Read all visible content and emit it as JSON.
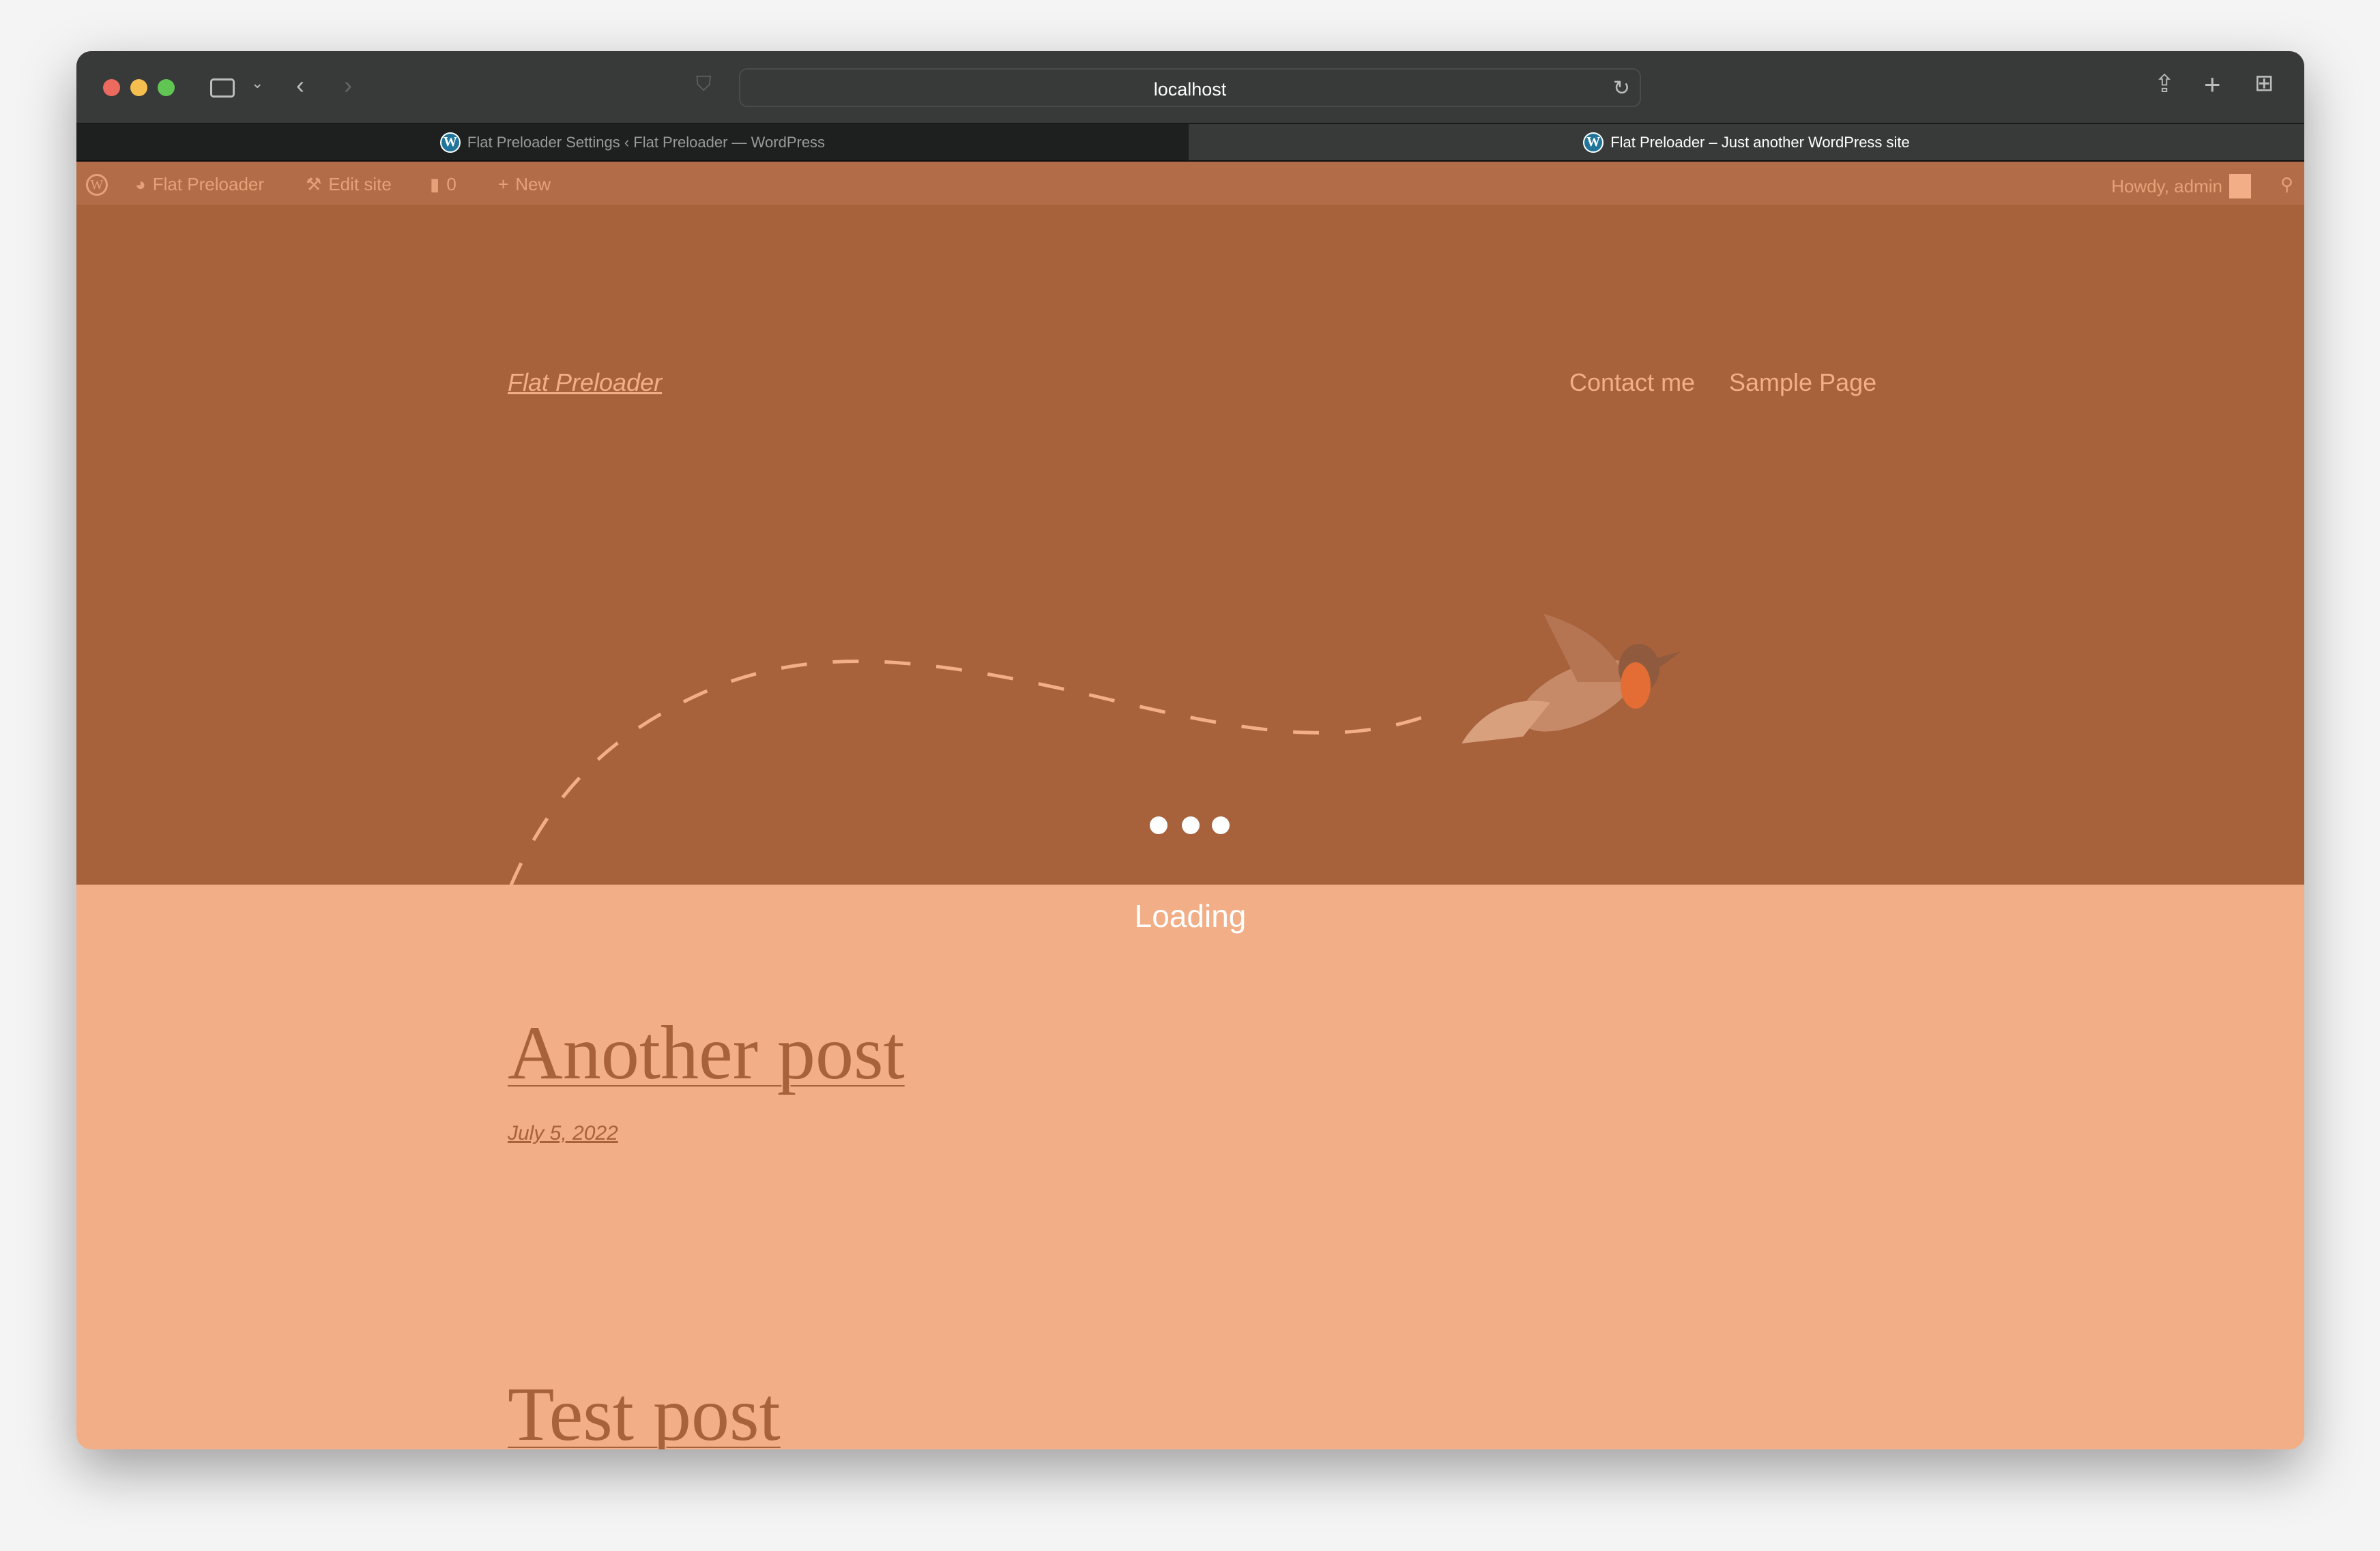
{
  "browser": {
    "url": "localhost",
    "tabs": [
      {
        "title": "Flat Preloader Settings ‹ Flat Preloader — WordPress",
        "active": false
      },
      {
        "title": "Flat Preloader – Just another WordPress site",
        "active": true
      }
    ]
  },
  "admin_bar": {
    "site": "Flat Preloader",
    "edit": "Edit site",
    "comments": "0",
    "new": "New",
    "howdy": "Howdy, admin"
  },
  "site": {
    "title": "Flat Preloader",
    "nav": [
      "Contact me",
      "Sample Page"
    ]
  },
  "preloader": {
    "text": "Loading"
  },
  "posts": [
    {
      "title": "Another post",
      "date": "July 5, 2022"
    },
    {
      "title": "Test post"
    }
  ],
  "colors": {
    "admin_bar": "#b36c48",
    "overlay": "#a7623c",
    "background": "#f2ae87",
    "accent": "#f2ae87"
  }
}
